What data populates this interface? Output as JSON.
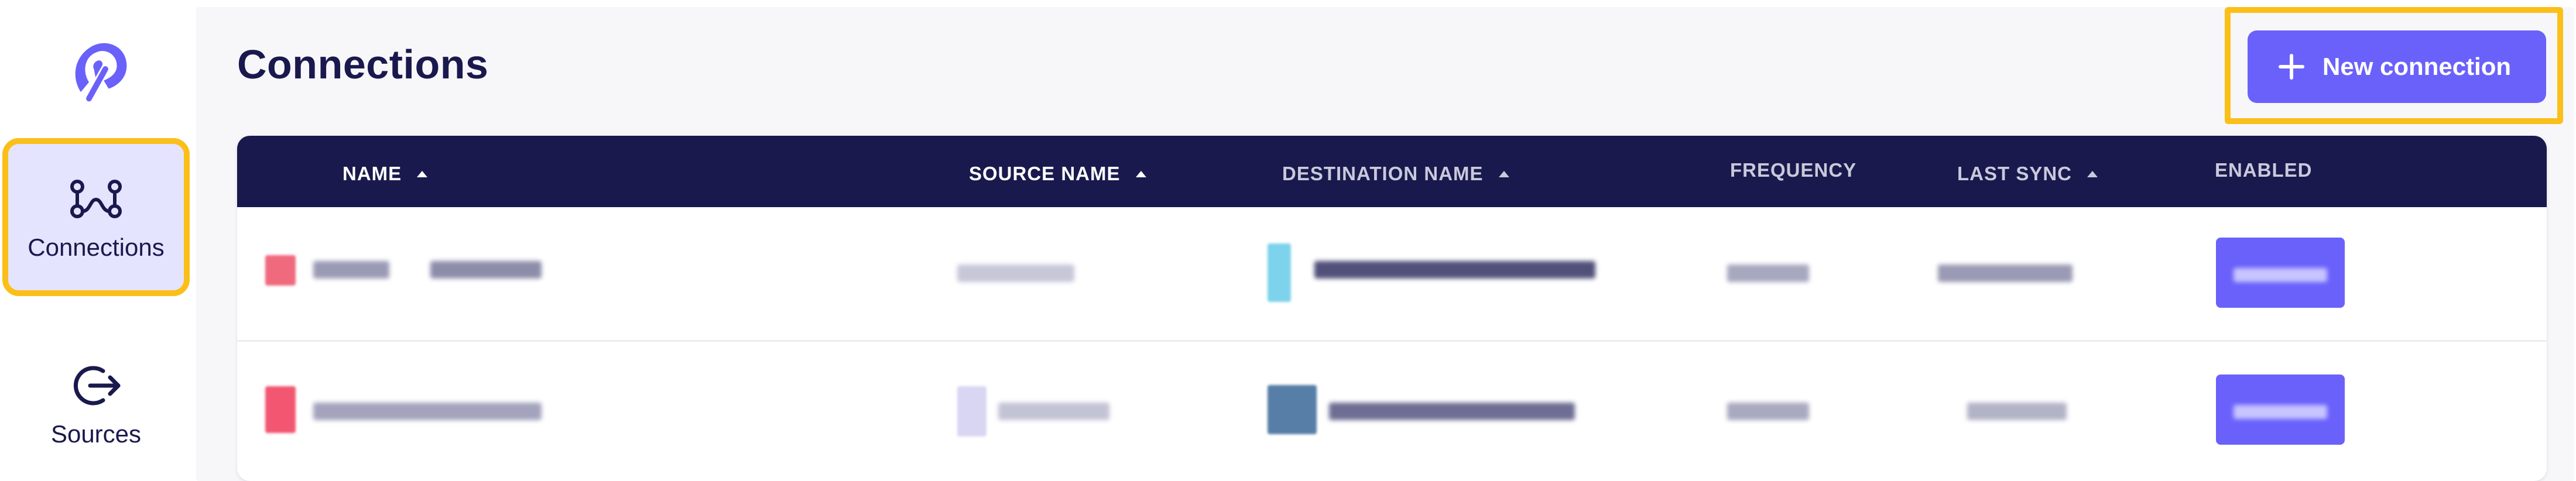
{
  "sidebar": {
    "logo_icon": "airbyte-logo-icon",
    "items": [
      {
        "label": "Connections",
        "icon": "connections-icon",
        "active": true
      },
      {
        "label": "Sources",
        "icon": "sources-icon",
        "active": false
      }
    ]
  },
  "header": {
    "title": "Connections",
    "new_connection_label": "New connection",
    "new_connection_icon": "plus-icon"
  },
  "table": {
    "columns": [
      {
        "label": "NAME",
        "sortable": true
      },
      {
        "label": "SOURCE NAME",
        "sortable": true
      },
      {
        "label": "DESTINATION NAME",
        "sortable": true
      },
      {
        "label": "FREQUENCY",
        "sortable": false
      },
      {
        "label": "LAST SYNC",
        "sortable": true
      },
      {
        "label": "ENABLED",
        "sortable": false
      }
    ],
    "rows_count_visible": 2
  },
  "colors": {
    "accent": "#6a61fb",
    "header_bg": "#1a194d",
    "highlight": "#fbbf1a",
    "active_nav_bg": "#e5e4ff"
  }
}
